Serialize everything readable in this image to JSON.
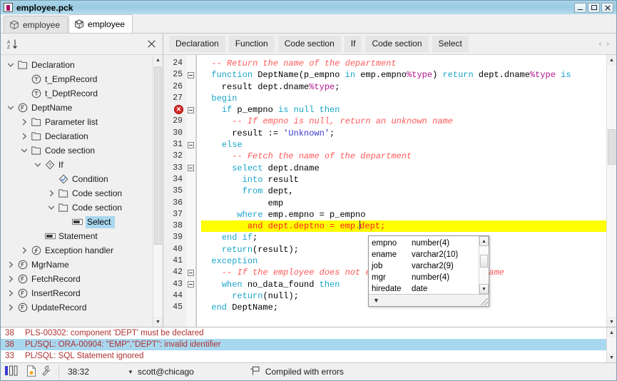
{
  "window": {
    "title": "employee.pck",
    "icon": "package-file-icon",
    "buttons": [
      {
        "name": "minimize-button",
        "label": "–"
      },
      {
        "name": "maximize-button",
        "label": "□"
      },
      {
        "name": "close-button",
        "label": "✕"
      }
    ]
  },
  "tabs": [
    {
      "label": "employee",
      "icon": "package-spec-icon",
      "active": false
    },
    {
      "label": "employee",
      "icon": "package-body-icon",
      "active": true
    }
  ],
  "tree_toolbar": {
    "sort_icon": "sort-az-icon",
    "close_icon": "close-icon"
  },
  "tree": [
    {
      "label": "Declaration",
      "indent": 0,
      "twist": "expanded",
      "icon": "folder-icon",
      "selected": false
    },
    {
      "label": "t_EmpRecord",
      "indent": 1,
      "twist": "none",
      "icon": "type-icon",
      "selected": false
    },
    {
      "label": "t_DeptRecord",
      "indent": 1,
      "twist": "none",
      "icon": "type-icon",
      "selected": false
    },
    {
      "label": "DeptName",
      "indent": 0,
      "twist": "expanded",
      "icon": "function-icon",
      "selected": false
    },
    {
      "label": "Parameter list",
      "indent": 1,
      "twist": "collapsed",
      "icon": "folder-icon",
      "selected": false
    },
    {
      "label": "Declaration",
      "indent": 1,
      "twist": "collapsed",
      "icon": "folder-icon",
      "selected": false
    },
    {
      "label": "Code section",
      "indent": 1,
      "twist": "expanded",
      "icon": "folder-icon",
      "selected": false
    },
    {
      "label": "If",
      "indent": 2,
      "twist": "expanded",
      "icon": "if-icon",
      "selected": false
    },
    {
      "label": "Condition",
      "indent": 3,
      "twist": "none",
      "icon": "condition-icon",
      "selected": false
    },
    {
      "label": "Code section",
      "indent": 3,
      "twist": "collapsed",
      "icon": "folder-icon",
      "selected": false
    },
    {
      "label": "Code section",
      "indent": 3,
      "twist": "expanded",
      "icon": "folder-icon",
      "selected": false
    },
    {
      "label": "Select",
      "indent": 4,
      "twist": "none",
      "icon": "statement-icon",
      "selected": true
    },
    {
      "label": "Statement",
      "indent": 2,
      "twist": "none",
      "icon": "statement-icon",
      "selected": false
    },
    {
      "label": "Exception handler",
      "indent": 1,
      "twist": "collapsed",
      "icon": "exception-icon",
      "selected": false
    },
    {
      "label": "MgrName",
      "indent": 0,
      "twist": "collapsed",
      "icon": "function-icon",
      "selected": false
    },
    {
      "label": "FetchRecord",
      "indent": 0,
      "twist": "collapsed",
      "icon": "function-icon",
      "selected": false
    },
    {
      "label": "InsertRecord",
      "indent": 0,
      "twist": "collapsed",
      "icon": "function-icon",
      "selected": false
    },
    {
      "label": "UpdateRecord",
      "indent": 0,
      "twist": "collapsed",
      "icon": "function-icon",
      "selected": false
    }
  ],
  "breadcrumb": {
    "items": [
      "Declaration",
      "Function",
      "Code section",
      "If",
      "Code section",
      "Select"
    ],
    "nav_prev": "‹",
    "nav_next": "›"
  },
  "editor": {
    "first_line": 24,
    "highlight_line": 38,
    "error_line": 28,
    "lines": [
      {
        "num": "24",
        "fold": false,
        "error": false,
        "highlight": false,
        "tokens": [
          {
            "t": "  ",
            "c": "op"
          },
          {
            "t": "-- Return the name of the department",
            "c": "cm"
          }
        ]
      },
      {
        "num": "25",
        "fold": true,
        "error": false,
        "highlight": false,
        "tokens": [
          {
            "t": "  ",
            "c": "op"
          },
          {
            "t": "function",
            "c": "k"
          },
          {
            "t": " DeptName(p_empno ",
            "c": "id"
          },
          {
            "t": "in",
            "c": "k"
          },
          {
            "t": " emp.empno",
            "c": "id"
          },
          {
            "t": "%type",
            "c": "pct"
          },
          {
            "t": ") ",
            "c": "id"
          },
          {
            "t": "return",
            "c": "k"
          },
          {
            "t": " dept.dname",
            "c": "id"
          },
          {
            "t": "%type",
            "c": "pct"
          },
          {
            "t": " ",
            "c": "id"
          },
          {
            "t": "is",
            "c": "k"
          }
        ]
      },
      {
        "num": "26",
        "fold": false,
        "error": false,
        "highlight": false,
        "tokens": [
          {
            "t": "    result dept.dname",
            "c": "id"
          },
          {
            "t": "%type",
            "c": "pct"
          },
          {
            "t": ";",
            "c": "id"
          }
        ]
      },
      {
        "num": "27",
        "fold": false,
        "error": false,
        "highlight": false,
        "tokens": [
          {
            "t": "  ",
            "c": "op"
          },
          {
            "t": "begin",
            "c": "k"
          }
        ]
      },
      {
        "num": "28",
        "fold": true,
        "error": true,
        "highlight": false,
        "tokens": [
          {
            "t": "    ",
            "c": "op"
          },
          {
            "t": "if",
            "c": "k"
          },
          {
            "t": " p_empno ",
            "c": "id"
          },
          {
            "t": "is null then",
            "c": "k"
          }
        ]
      },
      {
        "num": "29",
        "fold": false,
        "error": false,
        "highlight": false,
        "tokens": [
          {
            "t": "      ",
            "c": "op"
          },
          {
            "t": "-- If empno is null, return an unknown name",
            "c": "cm"
          }
        ]
      },
      {
        "num": "30",
        "fold": false,
        "error": false,
        "highlight": false,
        "tokens": [
          {
            "t": "      result := ",
            "c": "id"
          },
          {
            "t": "'Unknown'",
            "c": "st"
          },
          {
            "t": ";",
            "c": "id"
          }
        ]
      },
      {
        "num": "31",
        "fold": true,
        "error": false,
        "highlight": false,
        "tokens": [
          {
            "t": "    ",
            "c": "op"
          },
          {
            "t": "else",
            "c": "k"
          }
        ]
      },
      {
        "num": "32",
        "fold": false,
        "error": false,
        "highlight": false,
        "tokens": [
          {
            "t": "      ",
            "c": "op"
          },
          {
            "t": "-- Fetch the name of the department",
            "c": "cm"
          }
        ]
      },
      {
        "num": "33",
        "fold": true,
        "error": false,
        "highlight": false,
        "tokens": [
          {
            "t": "      ",
            "c": "op"
          },
          {
            "t": "select",
            "c": "k"
          },
          {
            "t": " dept.dname",
            "c": "id"
          }
        ]
      },
      {
        "num": "34",
        "fold": false,
        "error": false,
        "highlight": false,
        "tokens": [
          {
            "t": "        ",
            "c": "op"
          },
          {
            "t": "into",
            "c": "k"
          },
          {
            "t": " result",
            "c": "id"
          }
        ]
      },
      {
        "num": "35",
        "fold": false,
        "error": false,
        "highlight": false,
        "tokens": [
          {
            "t": "        ",
            "c": "op"
          },
          {
            "t": "from",
            "c": "k"
          },
          {
            "t": " dept,",
            "c": "id"
          }
        ]
      },
      {
        "num": "36",
        "fold": false,
        "error": false,
        "highlight": false,
        "tokens": [
          {
            "t": "             emp",
            "c": "id"
          }
        ]
      },
      {
        "num": "37",
        "fold": false,
        "error": false,
        "highlight": false,
        "tokens": [
          {
            "t": "       ",
            "c": "op"
          },
          {
            "t": "where",
            "c": "k"
          },
          {
            "t": " emp.empno = p_empno",
            "c": "id"
          }
        ]
      },
      {
        "num": "38",
        "fold": false,
        "error": false,
        "highlight": true,
        "tokens": [
          {
            "t": "         ",
            "c": "op"
          },
          {
            "t": "and",
            "c": "k"
          },
          {
            "t": " dept.deptno = emp.",
            "c": "id"
          },
          {
            "t": "\u0000caret",
            "c": "caret"
          },
          {
            "t": "dept;",
            "c": "id"
          }
        ]
      },
      {
        "num": "39",
        "fold": false,
        "error": false,
        "highlight": false,
        "tokens": [
          {
            "t": "    ",
            "c": "op"
          },
          {
            "t": "end if",
            "c": "k"
          },
          {
            "t": ";",
            "c": "id"
          }
        ]
      },
      {
        "num": "40",
        "fold": false,
        "error": false,
        "highlight": false,
        "tokens": [
          {
            "t": "    ",
            "c": "op"
          },
          {
            "t": "return",
            "c": "k"
          },
          {
            "t": "(result);",
            "c": "id"
          }
        ]
      },
      {
        "num": "41",
        "fold": false,
        "error": false,
        "highlight": false,
        "tokens": [
          {
            "t": "  ",
            "c": "op"
          },
          {
            "t": "exception",
            "c": "k"
          }
        ]
      },
      {
        "num": "42",
        "fold": true,
        "error": false,
        "highlight": false,
        "tokens": [
          {
            "t": "    ",
            "c": "op"
          },
          {
            "t": "-- If the employee does not exist, return an empty name",
            "c": "cm"
          }
        ]
      },
      {
        "num": "43",
        "fold": true,
        "error": false,
        "highlight": false,
        "tokens": [
          {
            "t": "    ",
            "c": "op"
          },
          {
            "t": "when",
            "c": "k"
          },
          {
            "t": " no_data_found ",
            "c": "id"
          },
          {
            "t": "then",
            "c": "k"
          }
        ]
      },
      {
        "num": "44",
        "fold": false,
        "error": false,
        "highlight": false,
        "tokens": [
          {
            "t": "      ",
            "c": "op"
          },
          {
            "t": "return",
            "c": "k"
          },
          {
            "t": "(null);",
            "c": "id"
          }
        ]
      },
      {
        "num": "45",
        "fold": false,
        "error": false,
        "highlight": false,
        "tokens": [
          {
            "t": "  ",
            "c": "op"
          },
          {
            "t": "end",
            "c": "k"
          },
          {
            "t": " DeptName;",
            "c": "id"
          }
        ]
      }
    ]
  },
  "autocomplete": {
    "rows": [
      {
        "name": "empno",
        "type": "number(4)"
      },
      {
        "name": "ename",
        "type": "varchar2(10)"
      },
      {
        "name": "job",
        "type": "varchar2(9)"
      },
      {
        "name": "mgr",
        "type": "number(4)"
      },
      {
        "name": "hiredate",
        "type": "date"
      }
    ],
    "up_arrow": "▲",
    "down_arrow": "▼",
    "footer_icon": "▼"
  },
  "errors": {
    "rows": [
      {
        "line": "38",
        "message": "PLS-00302: component 'DEPT' must be declared",
        "selected": false
      },
      {
        "line": "38",
        "message": "PL/SQL: ORA-00904: \"EMP\".\"DEPT\": invalid identifier",
        "selected": true
      },
      {
        "line": "33",
        "message": "PL/SQL: SQL Statement ignored",
        "selected": false
      }
    ]
  },
  "statusbar": {
    "bars_icon": "bars-icon",
    "newfile_icon": "new-file-icon",
    "wrench_icon": "wrench-icon",
    "position": "38:32",
    "dropdown_caret": "▼",
    "connection": "scott@chicago",
    "compile_icon": "flag-icon",
    "compile_status": "Compiled with errors"
  }
}
